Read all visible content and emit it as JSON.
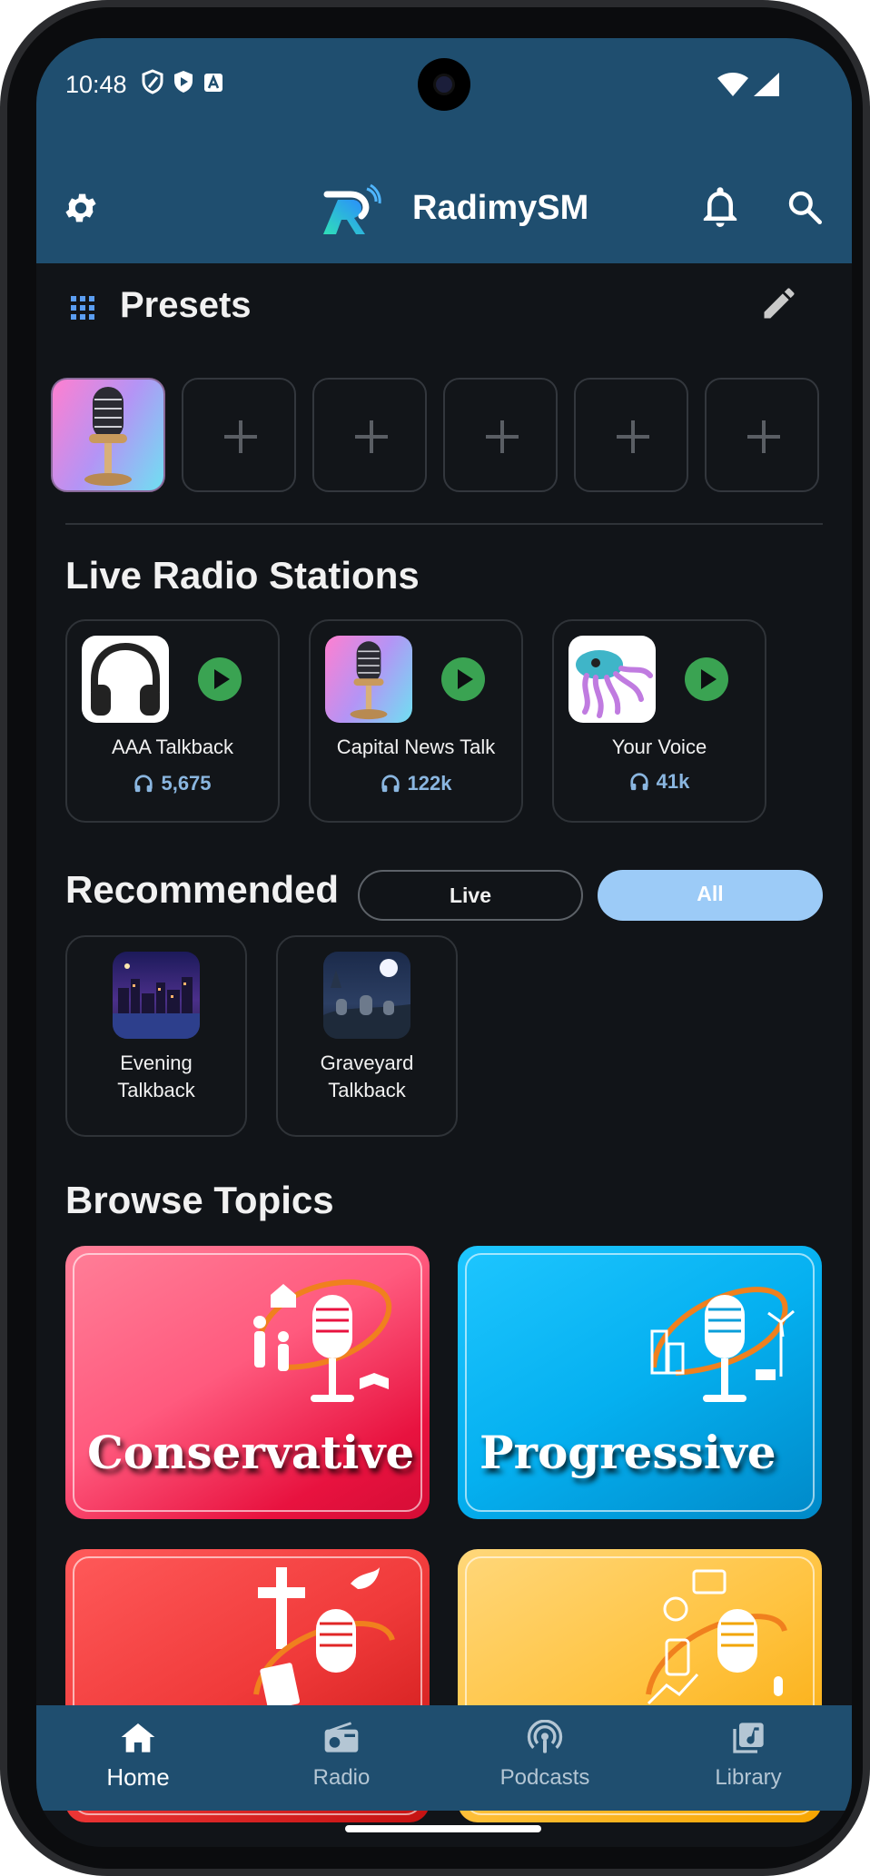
{
  "status_bar": {
    "time": "10:48"
  },
  "app_bar": {
    "title": "RadimySM"
  },
  "presets": {
    "title": "Presets"
  },
  "live_stations": {
    "title": "Live Radio Stations",
    "items": [
      {
        "name": "AAA Talkback",
        "listeners": "5,675",
        "logo": "headphones-logo"
      },
      {
        "name": "Capital News Talk",
        "listeners": "122k",
        "logo": "microphone-logo"
      },
      {
        "name": "Your Voice",
        "listeners": "41k",
        "logo": "squid-logo"
      }
    ]
  },
  "recommended": {
    "title": "Recommended",
    "filters": {
      "live": "Live",
      "all": "All"
    },
    "items": [
      {
        "line1": "Evening",
        "line2": "Talkback"
      },
      {
        "line1": "Graveyard",
        "line2": "Talkback"
      }
    ]
  },
  "topics": {
    "title": "Browse Topics",
    "items": [
      {
        "label": "Conservative"
      },
      {
        "label": "Progressive"
      },
      {
        "label": ""
      },
      {
        "label": ""
      }
    ]
  },
  "bottom_nav": {
    "home": "Home",
    "radio": "Radio",
    "podcasts": "Podcasts",
    "library": "Library"
  },
  "colors": {
    "bar": "#1f4e6f",
    "background": "#111418",
    "play": "#3aa352",
    "accent": "#9ccbf7",
    "listeners": "#8ab6e0"
  }
}
